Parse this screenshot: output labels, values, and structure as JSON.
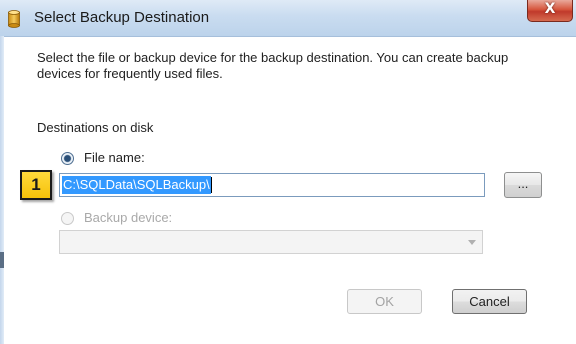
{
  "window": {
    "title": "Select Backup Destination",
    "icon": "database-cylinder-icon",
    "close_label": "X"
  },
  "dialog": {
    "description": "Select the file or backup device for the backup destination. You can create backup devices for frequently used files.",
    "section_label": "Destinations on disk",
    "file_name_option": {
      "label": "File name:",
      "selected": true,
      "value": "C:\\SQLData\\SQLBackup\\"
    },
    "browse_label": "...",
    "backup_device_option": {
      "label": "Backup device:",
      "selected": false,
      "enabled": false,
      "value": ""
    },
    "ok_label": "OK",
    "cancel_label": "Cancel"
  },
  "callout": {
    "number": "1"
  },
  "colors": {
    "selection": "#3399ff",
    "callout": "#f6c20a",
    "close_button": "#c0392b"
  }
}
